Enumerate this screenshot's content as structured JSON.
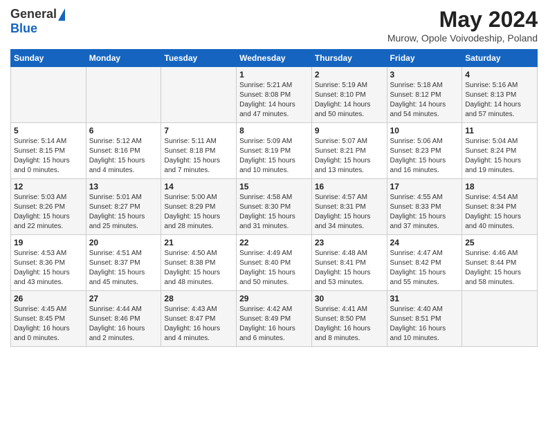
{
  "header": {
    "logo_general": "General",
    "logo_blue": "Blue",
    "month_year": "May 2024",
    "location": "Murow, Opole Voivodeship, Poland"
  },
  "days_of_week": [
    "Sunday",
    "Monday",
    "Tuesday",
    "Wednesday",
    "Thursday",
    "Friday",
    "Saturday"
  ],
  "weeks": [
    [
      {
        "day": "",
        "info": ""
      },
      {
        "day": "",
        "info": ""
      },
      {
        "day": "",
        "info": ""
      },
      {
        "day": "1",
        "info": "Sunrise: 5:21 AM\nSunset: 8:08 PM\nDaylight: 14 hours\nand 47 minutes."
      },
      {
        "day": "2",
        "info": "Sunrise: 5:19 AM\nSunset: 8:10 PM\nDaylight: 14 hours\nand 50 minutes."
      },
      {
        "day": "3",
        "info": "Sunrise: 5:18 AM\nSunset: 8:12 PM\nDaylight: 14 hours\nand 54 minutes."
      },
      {
        "day": "4",
        "info": "Sunrise: 5:16 AM\nSunset: 8:13 PM\nDaylight: 14 hours\nand 57 minutes."
      }
    ],
    [
      {
        "day": "5",
        "info": "Sunrise: 5:14 AM\nSunset: 8:15 PM\nDaylight: 15 hours\nand 0 minutes."
      },
      {
        "day": "6",
        "info": "Sunrise: 5:12 AM\nSunset: 8:16 PM\nDaylight: 15 hours\nand 4 minutes."
      },
      {
        "day": "7",
        "info": "Sunrise: 5:11 AM\nSunset: 8:18 PM\nDaylight: 15 hours\nand 7 minutes."
      },
      {
        "day": "8",
        "info": "Sunrise: 5:09 AM\nSunset: 8:19 PM\nDaylight: 15 hours\nand 10 minutes."
      },
      {
        "day": "9",
        "info": "Sunrise: 5:07 AM\nSunset: 8:21 PM\nDaylight: 15 hours\nand 13 minutes."
      },
      {
        "day": "10",
        "info": "Sunrise: 5:06 AM\nSunset: 8:23 PM\nDaylight: 15 hours\nand 16 minutes."
      },
      {
        "day": "11",
        "info": "Sunrise: 5:04 AM\nSunset: 8:24 PM\nDaylight: 15 hours\nand 19 minutes."
      }
    ],
    [
      {
        "day": "12",
        "info": "Sunrise: 5:03 AM\nSunset: 8:26 PM\nDaylight: 15 hours\nand 22 minutes."
      },
      {
        "day": "13",
        "info": "Sunrise: 5:01 AM\nSunset: 8:27 PM\nDaylight: 15 hours\nand 25 minutes."
      },
      {
        "day": "14",
        "info": "Sunrise: 5:00 AM\nSunset: 8:29 PM\nDaylight: 15 hours\nand 28 minutes."
      },
      {
        "day": "15",
        "info": "Sunrise: 4:58 AM\nSunset: 8:30 PM\nDaylight: 15 hours\nand 31 minutes."
      },
      {
        "day": "16",
        "info": "Sunrise: 4:57 AM\nSunset: 8:31 PM\nDaylight: 15 hours\nand 34 minutes."
      },
      {
        "day": "17",
        "info": "Sunrise: 4:55 AM\nSunset: 8:33 PM\nDaylight: 15 hours\nand 37 minutes."
      },
      {
        "day": "18",
        "info": "Sunrise: 4:54 AM\nSunset: 8:34 PM\nDaylight: 15 hours\nand 40 minutes."
      }
    ],
    [
      {
        "day": "19",
        "info": "Sunrise: 4:53 AM\nSunset: 8:36 PM\nDaylight: 15 hours\nand 43 minutes."
      },
      {
        "day": "20",
        "info": "Sunrise: 4:51 AM\nSunset: 8:37 PM\nDaylight: 15 hours\nand 45 minutes."
      },
      {
        "day": "21",
        "info": "Sunrise: 4:50 AM\nSunset: 8:38 PM\nDaylight: 15 hours\nand 48 minutes."
      },
      {
        "day": "22",
        "info": "Sunrise: 4:49 AM\nSunset: 8:40 PM\nDaylight: 15 hours\nand 50 minutes."
      },
      {
        "day": "23",
        "info": "Sunrise: 4:48 AM\nSunset: 8:41 PM\nDaylight: 15 hours\nand 53 minutes."
      },
      {
        "day": "24",
        "info": "Sunrise: 4:47 AM\nSunset: 8:42 PM\nDaylight: 15 hours\nand 55 minutes."
      },
      {
        "day": "25",
        "info": "Sunrise: 4:46 AM\nSunset: 8:44 PM\nDaylight: 15 hours\nand 58 minutes."
      }
    ],
    [
      {
        "day": "26",
        "info": "Sunrise: 4:45 AM\nSunset: 8:45 PM\nDaylight: 16 hours\nand 0 minutes."
      },
      {
        "day": "27",
        "info": "Sunrise: 4:44 AM\nSunset: 8:46 PM\nDaylight: 16 hours\nand 2 minutes."
      },
      {
        "day": "28",
        "info": "Sunrise: 4:43 AM\nSunset: 8:47 PM\nDaylight: 16 hours\nand 4 minutes."
      },
      {
        "day": "29",
        "info": "Sunrise: 4:42 AM\nSunset: 8:49 PM\nDaylight: 16 hours\nand 6 minutes."
      },
      {
        "day": "30",
        "info": "Sunrise: 4:41 AM\nSunset: 8:50 PM\nDaylight: 16 hours\nand 8 minutes."
      },
      {
        "day": "31",
        "info": "Sunrise: 4:40 AM\nSunset: 8:51 PM\nDaylight: 16 hours\nand 10 minutes."
      },
      {
        "day": "",
        "info": ""
      }
    ]
  ]
}
